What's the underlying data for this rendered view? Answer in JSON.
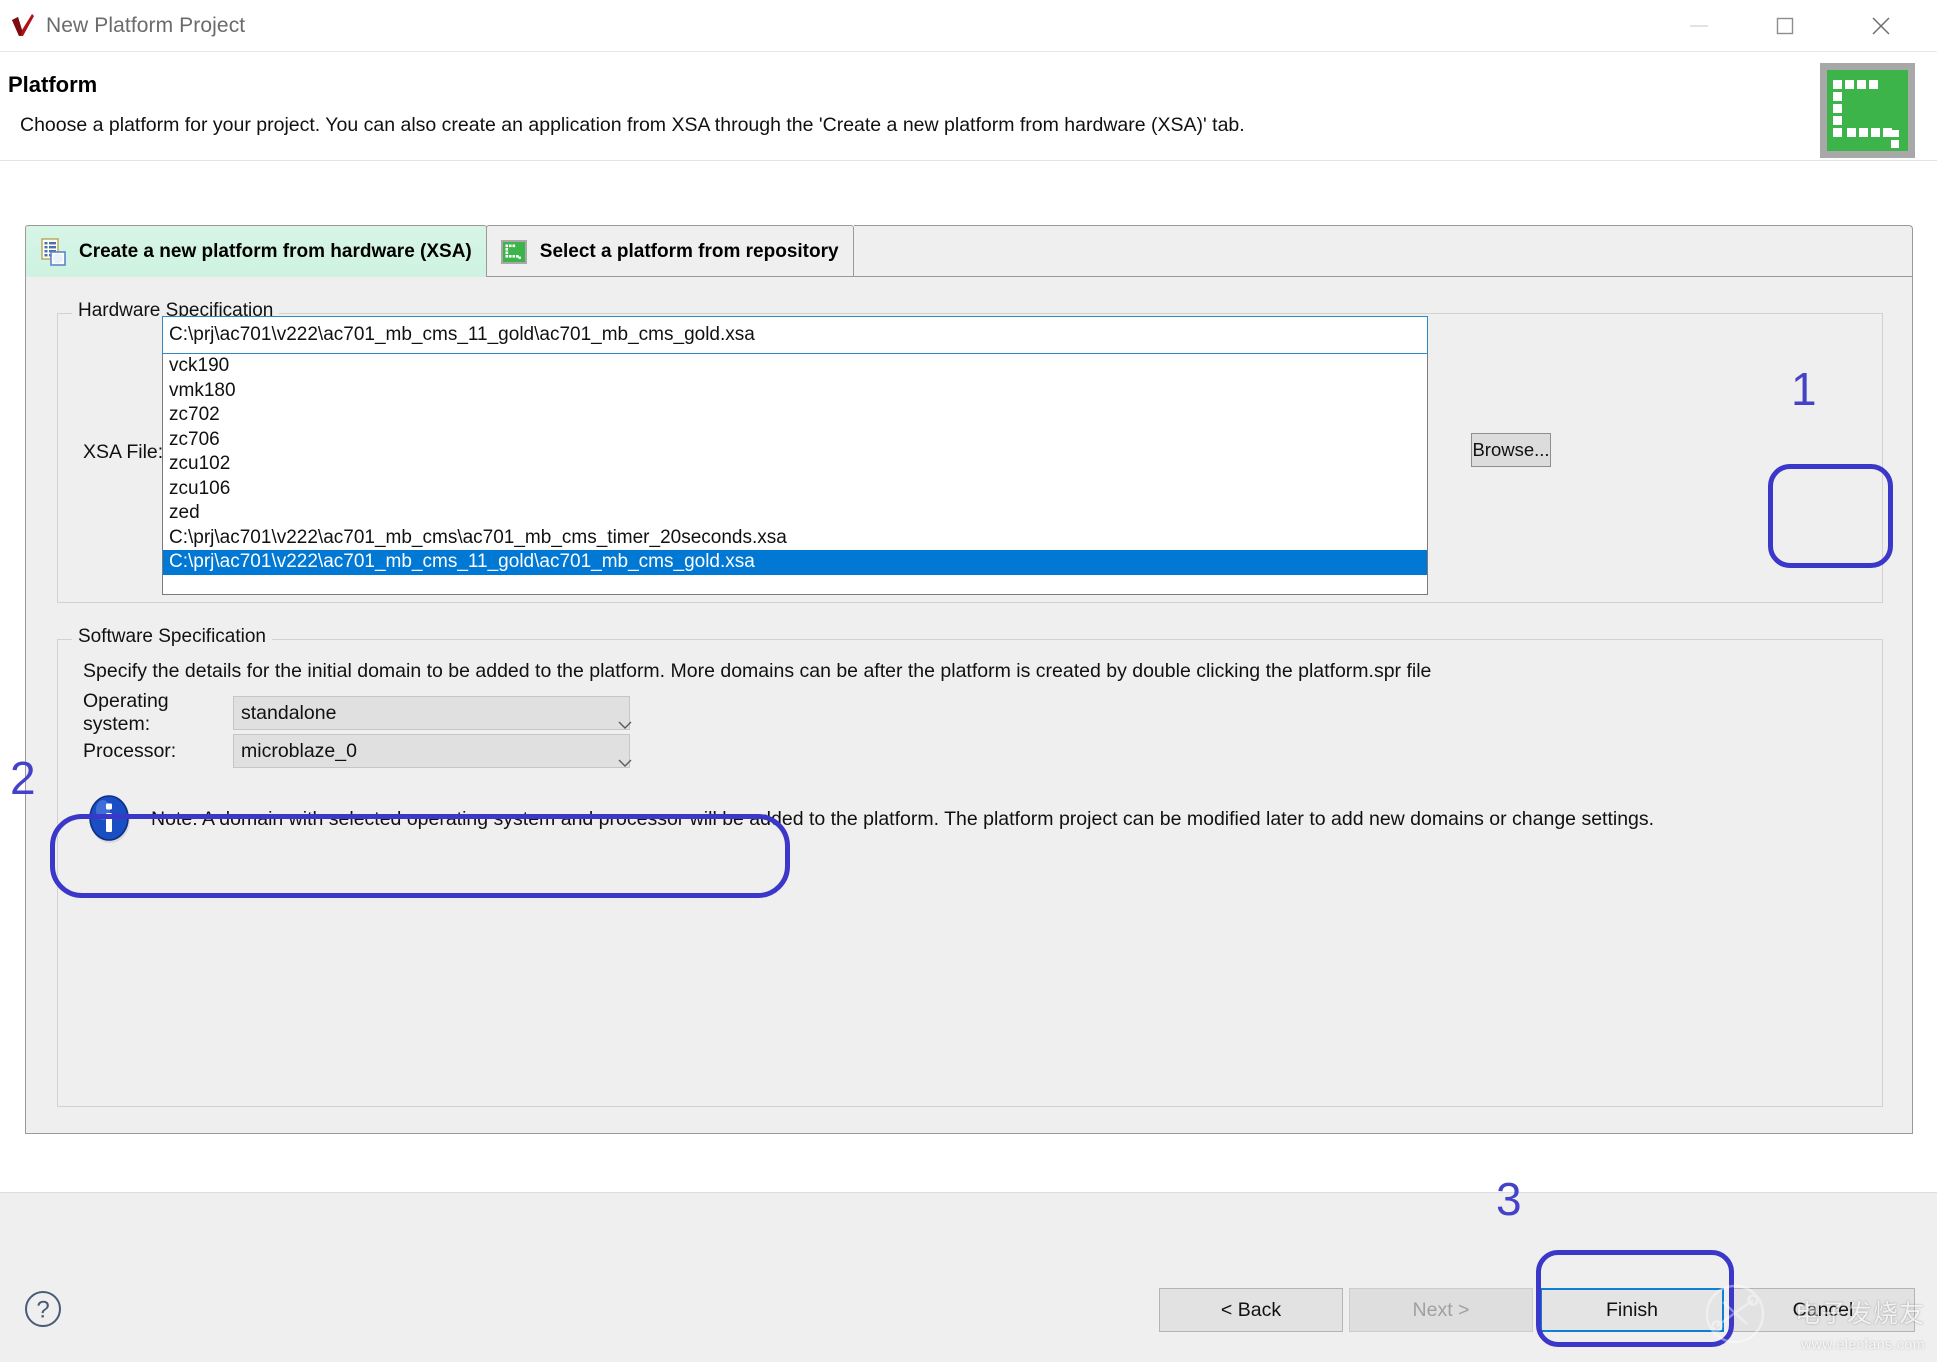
{
  "window": {
    "title": "New Platform Project",
    "app_icon": "vitis-checkmark-icon",
    "minimize_label": "Minimize",
    "maximize_label": "Maximize",
    "close_label": "Close"
  },
  "header": {
    "title": "Platform",
    "description": "Choose a platform for your project. You can also create an application from XSA through the 'Create a new platform from hardware (XSA)' tab.",
    "logo": "xilinx-vitis-green-logo"
  },
  "tabs": [
    {
      "label": "Create a new platform from hardware (XSA)",
      "icon": "new-platform-from-hardware-icon",
      "selected": true
    },
    {
      "label": "Select a platform from repository",
      "icon": "platform-repository-icon",
      "selected": false
    }
  ],
  "hardware_spec": {
    "group_title": "Hardware Specification",
    "xsa_file_label": "XSA File:",
    "xsa_input_value": "C:\\prj\\ac701\\v222\\ac701_mb_cms_11_gold\\ac701_mb_cms_gold.xsa",
    "xsa_input_placeholder": "",
    "browse_label": "Browse...",
    "dropdown_items": [
      {
        "label": "vck190",
        "selected": false
      },
      {
        "label": "vmk180",
        "selected": false
      },
      {
        "label": "zc702",
        "selected": false
      },
      {
        "label": "zc706",
        "selected": false
      },
      {
        "label": "zcu102",
        "selected": false
      },
      {
        "label": "zcu106",
        "selected": false
      },
      {
        "label": "zed",
        "selected": false
      },
      {
        "label": "C:\\prj\\ac701\\v222\\ac701_mb_cms\\ac701_mb_cms_timer_20seconds.xsa",
        "selected": false
      },
      {
        "label": "C:\\prj\\ac701\\v222\\ac701_mb_cms_11_gold\\ac701_mb_cms_gold.xsa",
        "selected": true
      }
    ]
  },
  "software_spec": {
    "group_title": "Software Specification",
    "description": "Specify the details for the initial domain to be added to the platform. More domains can be after the platform is created by double clicking the platform.spr file",
    "os_label": "Operating system:",
    "os_value": "standalone",
    "processor_label": "Processor:",
    "processor_value": "microblaze_0",
    "note_icon": "info-icon",
    "note_text": "Note: A domain with selected operating system and processor will be added to the platform. The platform project can be modified later to add new domains or change settings."
  },
  "footer": {
    "help_icon": "help-question-icon",
    "back_label": "< Back",
    "next_label": "Next >",
    "finish_label": "Finish",
    "cancel_label": "Cancel",
    "next_disabled": true,
    "finish_is_default": true
  },
  "annotations": {
    "color": "#3a37c9",
    "marks": [
      {
        "number": "1",
        "target": "browse-button"
      },
      {
        "number": "2",
        "target": "software-spec-fields"
      },
      {
        "number": "3",
        "target": "finish-button"
      }
    ]
  },
  "watermark": {
    "text": "电子发烧友",
    "url": "www.elecfans.com"
  },
  "colors": {
    "selection_blue": "#0078d4",
    "tab_selected_green": "#cff2e1",
    "logo_green": "#3cb44a",
    "annotation_blue": "#3a37c9",
    "panel_gray": "#efefef"
  }
}
